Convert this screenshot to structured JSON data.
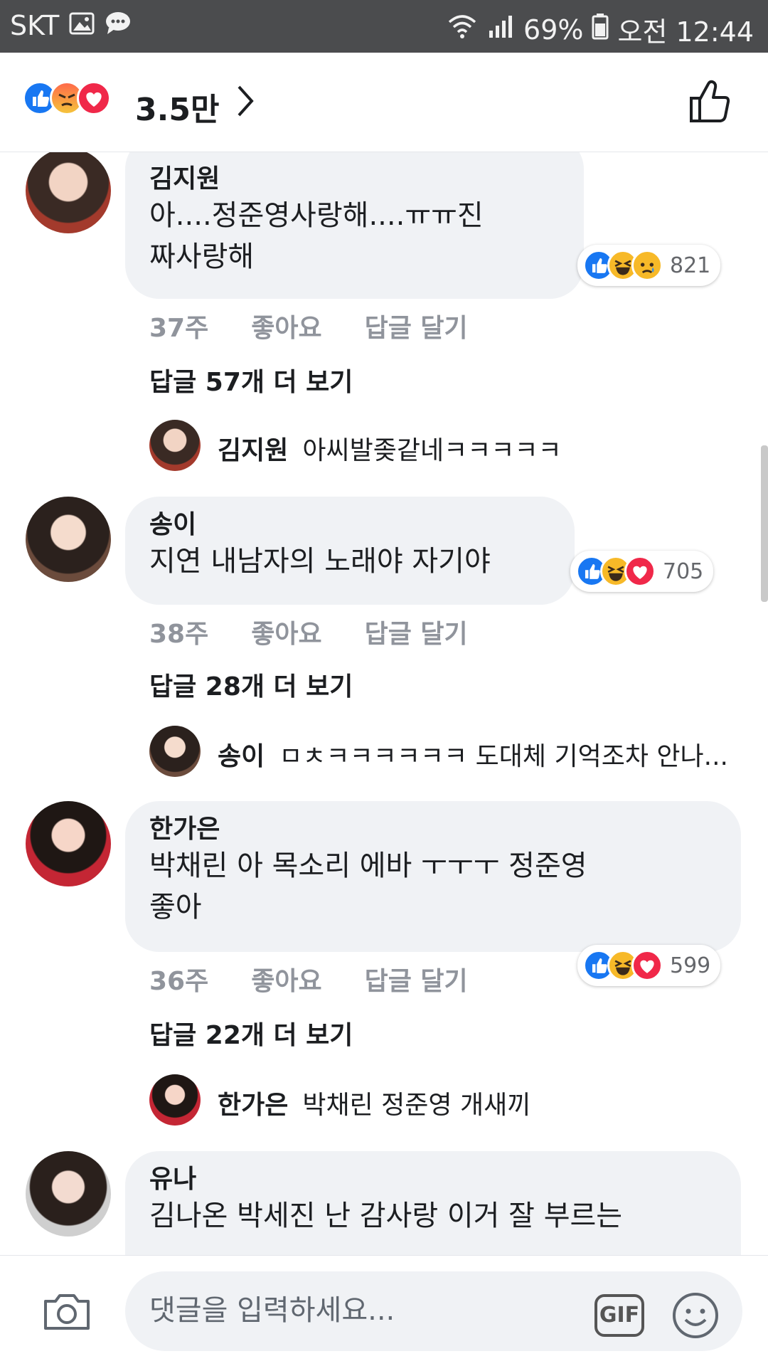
{
  "status_bar": {
    "carrier": "SKT",
    "battery": "69%",
    "time": "오전 12:44",
    "icons": [
      "gallery-icon",
      "message-icon",
      "wifi-icon",
      "signal-icon",
      "battery-icon"
    ]
  },
  "header": {
    "reactions": [
      "like",
      "angry",
      "love"
    ],
    "count": "3.5만"
  },
  "comments": [
    {
      "author": "김지원",
      "lines": [
        "아....정준영사랑해....ㅠㅠ진",
        "짜사랑해"
      ],
      "time": "37주",
      "like_label": "좋아요",
      "reply_label": "답글 달기",
      "more_replies": "답글 57개 더 보기",
      "reactions": [
        "like",
        "haha",
        "sad"
      ],
      "reaction_count": "821",
      "reply_preview": {
        "author": "김지원",
        "text": "아씨발좆같네ㅋㅋㅋㅋㅋ"
      }
    },
    {
      "author": "송이",
      "lines": [
        "지연 내남자의 노래야 자기야"
      ],
      "time": "38주",
      "like_label": "좋아요",
      "reply_label": "답글 달기",
      "more_replies": "답글 28개 더 보기",
      "reactions": [
        "like",
        "haha",
        "love"
      ],
      "reaction_count": "705",
      "reply_preview": {
        "author": "송이",
        "text": "ㅁㅊㅋㅋㅋㅋㅋㅋ 도대체 기억조차 안나..."
      }
    },
    {
      "author": "한가은",
      "lines": [
        "박채린 아 목소리 에바 ㅜㅜㅜ 정준영",
        "좋아"
      ],
      "time": "36주",
      "like_label": "좋아요",
      "reply_label": "답글 달기",
      "more_replies": "답글 22개 더 보기",
      "reactions": [
        "like",
        "haha",
        "love"
      ],
      "reaction_count": "599",
      "reply_preview": {
        "author": "한가은",
        "text": "박채린 정준영 개새끼"
      }
    },
    {
      "author": "유나",
      "lines": [
        "김나온 박세진 난 감사랑 이거 잘 부르는"
      ]
    }
  ],
  "input": {
    "placeholder": "댓글을 입력하세요...",
    "gif_label": "GIF"
  },
  "colors": {
    "status_bar": "#4b4c4e",
    "bubble": "#f0f2f5",
    "like_blue": "#1877f2",
    "love_red": "#f02849",
    "haha_yellow": "#f7b928",
    "meta_gray": "#90949c"
  }
}
